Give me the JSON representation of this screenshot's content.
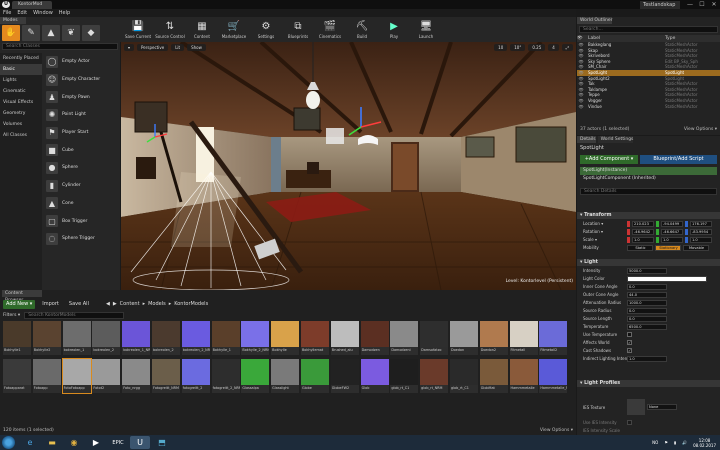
{
  "window": {
    "tab_title": "KontorMod",
    "project_name": "TestIandskap",
    "min": "—",
    "max": "☐",
    "close": "✕"
  },
  "menu": [
    "File",
    "Edit",
    "Window",
    "Help"
  ],
  "modes": {
    "tab": "Modes",
    "search_placeholder": "Search Classes",
    "categories": [
      "Recently Placed",
      "Basic",
      "Lights",
      "Cinematic",
      "Visual Effects",
      "Geometry",
      "Volumes",
      "All Classes"
    ],
    "items": [
      "Empty Actor",
      "Empty Character",
      "Empty Pawn",
      "Point Light",
      "Player Start",
      "Cube",
      "Sphere",
      "Cylinder",
      "Cone",
      "Box Trigger",
      "Sphere Trigger"
    ]
  },
  "toolbar": [
    "Save Current",
    "Source Control",
    "Content",
    "Marketplace",
    "Settings",
    "Blueprints",
    "Cinematics",
    "Build",
    "Play",
    "Launch"
  ],
  "viewport": {
    "perspective": "Perspective",
    "lit": "Lit",
    "show": "Show",
    "grid_snap": "10",
    "rot_snap": "10°",
    "scale_snap": "0.25",
    "cam_speed": "4",
    "level": "Level:  Kontorlevel (Persistent)"
  },
  "content_browser": {
    "tab": "Content Browser",
    "add_new": "Add New ▾",
    "import": "Import",
    "save_all": "Save All",
    "path": [
      "Content",
      "Models",
      "KontorModels"
    ],
    "filters": "Filters ▾",
    "search_placeholder": "Search KontorModels",
    "count": "120 items (1 selected)",
    "view_options": "View Options ▾",
    "assets": [
      {
        "name": "Bokhylle1",
        "c": "#4a3a2a"
      },
      {
        "name": "Bokhylle2",
        "c": "#5a4330"
      },
      {
        "name": "bokreolen_1",
        "c": "#6d6d6d"
      },
      {
        "name": "bokreolen_2",
        "c": "#5c5c5c"
      },
      {
        "name": "bokreolen_1_NRM",
        "c": "#6b55d8"
      },
      {
        "name": "bokreolen_2",
        "c": "#4b3a2e"
      },
      {
        "name": "bokreolen_2_NRM",
        "c": "#6a5be0"
      },
      {
        "name": "Bokhylle_1",
        "c": "#5a3f2a"
      },
      {
        "name": "Bokhylle_2_NRM",
        "c": "#7a70e8"
      },
      {
        "name": "Bokhylle",
        "c": "#d9a24a"
      },
      {
        "name": "Bokhyllemat",
        "c": "#7d3c2a"
      },
      {
        "name": "Brushed_alu",
        "c": "#bdbdbd"
      },
      {
        "name": "Damodzen",
        "c": "#5b2f22"
      },
      {
        "name": "Damodzeni",
        "c": "#8a8a8a"
      },
      {
        "name": "Damsofatzo",
        "c": "#2e2e2e"
      },
      {
        "name": "Doedon",
        "c": "#9a9a9a"
      },
      {
        "name": "Doedon2",
        "c": "#b07a4e"
      },
      {
        "name": "Fitmetall",
        "c": "#d7d0c4"
      },
      {
        "name": "Fitmetall2",
        "c": "#6b6bd8"
      },
      {
        "name": "Fotoapparat",
        "c": "#3a3a3a"
      },
      {
        "name": "Fotoapp",
        "c": "#6a6a6a"
      },
      {
        "name": "FotoFotoapp",
        "c": "#a8a8a8"
      },
      {
        "name": "Fotot2",
        "c": "#9a9a9a"
      },
      {
        "name": "Foto_nrgg",
        "c": "#8a8a8a"
      },
      {
        "name": "Fotogreitt_NRM",
        "c": "#6b5e4a"
      },
      {
        "name": "fotogreitt_2",
        "c": "#6b6be0"
      },
      {
        "name": "fotogreitt_2_NRM",
        "c": "#2d2d2d"
      },
      {
        "name": "Glassalpa",
        "c": "#3aa83a"
      },
      {
        "name": "Glasslight",
        "c": "#7a7a7a"
      },
      {
        "name": "Globe",
        "c": "#3a9a3a"
      },
      {
        "name": "GlobeFW2",
        "c": "#222222"
      },
      {
        "name": "Glob",
        "c": "#7b5be0"
      },
      {
        "name": "glob_rt_C1",
        "c": "#1e1e1e"
      },
      {
        "name": "glob_rt_NRM",
        "c": "#6a3a2a"
      },
      {
        "name": "glob_rt_C1",
        "c": "#2a2a2a"
      },
      {
        "name": "GlobMat",
        "c": "#7a5a3a"
      },
      {
        "name": "Hammmetalle",
        "c": "#8a5a3a"
      },
      {
        "name": "Hammmetalle_NRM",
        "c": "#5a5ad8"
      }
    ]
  },
  "outliner": {
    "tab": "World Outliner",
    "search_placeholder": "Search...",
    "col_label": "Label",
    "col_type": "Type",
    "rows": [
      {
        "l": "Bakkeglang",
        "t": "StaticMeshActor",
        "s": false
      },
      {
        "l": "Skap",
        "t": "StaticMeshActor",
        "s": false
      },
      {
        "l": "Skrivebord",
        "t": "StaticMeshActor",
        "s": false
      },
      {
        "l": "Sky Sphere",
        "t": "Edit BP_Sky_Sph",
        "s": false
      },
      {
        "l": "SM_Chair",
        "t": "StaticMeshActor",
        "s": false
      },
      {
        "l": "SpotLight",
        "t": "SpotLight",
        "s": true
      },
      {
        "l": "SpotLight2",
        "t": "SpotLight",
        "s": false
      },
      {
        "l": "Tak",
        "t": "StaticMeshActor",
        "s": false
      },
      {
        "l": "Taklampe",
        "t": "StaticMeshActor",
        "s": false
      },
      {
        "l": "Teppe",
        "t": "StaticMeshActor",
        "s": false
      },
      {
        "l": "Vegger",
        "t": "StaticMeshActor",
        "s": false
      },
      {
        "l": "Vindue",
        "t": "StaticMeshActor",
        "s": false
      }
    ],
    "count": "37 actors (1 selected)",
    "view_options": "View Options ▾"
  },
  "details": {
    "tab_details": "Details",
    "tab_world": "World Settings",
    "actor_name": "SpotLight",
    "add_component": "+Add Component ▾",
    "blueprint": "Blueprint/Add Script",
    "components": [
      "SpotLight(Instance)",
      "SpotLightComponent (Inherited)"
    ],
    "search_placeholder": "Search Details",
    "transform_header": "▾ Transform",
    "location_label": "Location ▾",
    "location": [
      "210.023",
      "-94.0499",
      "176.197"
    ],
    "rotation_label": "Rotation ▾",
    "rotation": [
      "-46.9642",
      "-46.6647",
      "-83.9954"
    ],
    "scale_label": "Scale ▾",
    "scale": [
      "1.0",
      "1.0",
      "1.0"
    ],
    "mobility_label": "Mobility",
    "mobility": [
      "Static",
      "Stationary",
      "Movable"
    ],
    "light_header": "▾ Light",
    "intensity_label": "Intensity",
    "intensity": "5000.0",
    "light_color_label": "Light Color",
    "inner_cone_label": "Inner Cone Angle",
    "inner_cone": "0.0",
    "outer_cone_label": "Outer Cone Angle",
    "outer_cone": "44.0",
    "atten_label": "Attenuation Radius",
    "atten": "1000.0",
    "src_radius_label": "Source Radius",
    "src_radius": "0.0",
    "src_len_label": "Source Length",
    "src_len": "0.0",
    "temp_label": "Temperature",
    "temp": "6500.0",
    "use_temp_label": "Use Temperature",
    "affects_label": "Affects World",
    "cast_shadows_label": "Cast Shadows",
    "indirect_label": "Indirect Lighting Inten",
    "indirect": "1.0",
    "profiles_header": "▾ Light Profiles",
    "ies_label": "IES Texture",
    "ies_value": "None",
    "use_ies_label": "Use IES Intensity",
    "ies_intensity_label": "IES Intensity Scale"
  },
  "taskbar": {
    "lang": "NO",
    "time": "12:08",
    "date": "08.02.2017"
  }
}
